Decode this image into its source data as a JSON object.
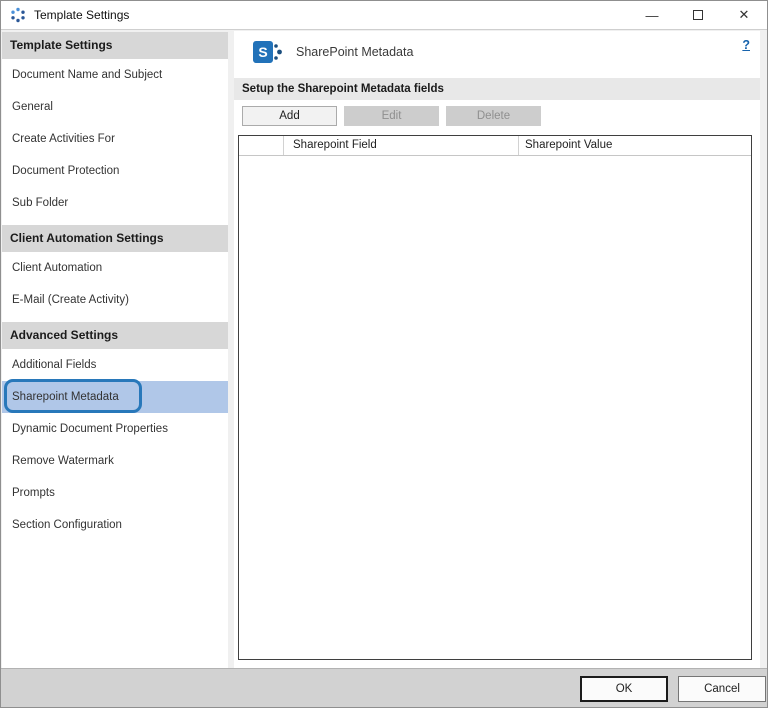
{
  "window": {
    "title": "Template Settings",
    "controls": {
      "minimize_glyph": "—",
      "close_glyph": "✕"
    }
  },
  "sidebar": {
    "sections": [
      {
        "header": "Template Settings",
        "items": [
          {
            "label": "Document Name and Subject"
          },
          {
            "label": "General"
          },
          {
            "label": "Create Activities For"
          },
          {
            "label": "Document Protection"
          },
          {
            "label": "Sub Folder"
          }
        ]
      },
      {
        "header": "Client Automation Settings",
        "items": [
          {
            "label": "Client Automation"
          },
          {
            "label": "E-Mail (Create Activity)"
          }
        ]
      },
      {
        "header": "Advanced Settings",
        "items": [
          {
            "label": "Additional Fields"
          },
          {
            "label": "Sharepoint Metadata",
            "selected": true
          },
          {
            "label": "Dynamic Document Properties"
          },
          {
            "label": "Remove Watermark"
          },
          {
            "label": "Prompts"
          },
          {
            "label": "Section Configuration"
          }
        ]
      }
    ]
  },
  "main": {
    "icon_letter": "S",
    "title": "SharePoint Metadata",
    "help_label": "?",
    "section_label": "Setup the Sharepoint Metadata fields",
    "toolbar": {
      "add": "Add",
      "edit": "Edit",
      "delete": "Delete"
    },
    "table": {
      "columns": [
        "",
        "Sharepoint Field",
        "Sharepoint Value"
      ],
      "rows": []
    }
  },
  "footer": {
    "ok": "OK",
    "cancel": "Cancel"
  },
  "colors": {
    "selection_bg": "#b0c7e8",
    "annotation_border": "#2878ba",
    "sharepoint_blue": "#2272b9",
    "help_link": "#1763ad"
  }
}
